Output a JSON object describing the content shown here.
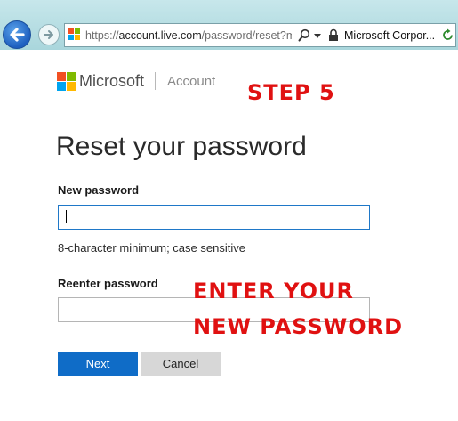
{
  "browser": {
    "url_prefix": "https://",
    "url_host": "account.live.com",
    "url_path": "/password/reset?m",
    "site_identity": "Microsoft Corpor...",
    "icons": [
      "back-arrow-icon",
      "forward-arrow-icon",
      "microsoft-favicon",
      "search-icon",
      "dropdown-icon",
      "lock-icon",
      "refresh-icon"
    ]
  },
  "brand": {
    "name": "Microsoft",
    "section": "Account",
    "logo_colors": [
      "#f25022",
      "#7fba00",
      "#00a4ef",
      "#ffb900"
    ]
  },
  "annotations": {
    "step": "STEP 5",
    "instruction_line1": "ENTER YOUR",
    "instruction_line2": "NEW PASSWORD",
    "color": "#e01111"
  },
  "form": {
    "title": "Reset your password",
    "new_password": {
      "label": "New password",
      "value": "",
      "hint": "8-character minimum; case sensitive"
    },
    "reenter_password": {
      "label": "Reenter password",
      "value": ""
    },
    "next_label": "Next",
    "cancel_label": "Cancel"
  },
  "colors": {
    "primary_button": "#0f6cc7",
    "secondary_button": "#d7d7d7",
    "focus_border": "#1f78c8"
  }
}
